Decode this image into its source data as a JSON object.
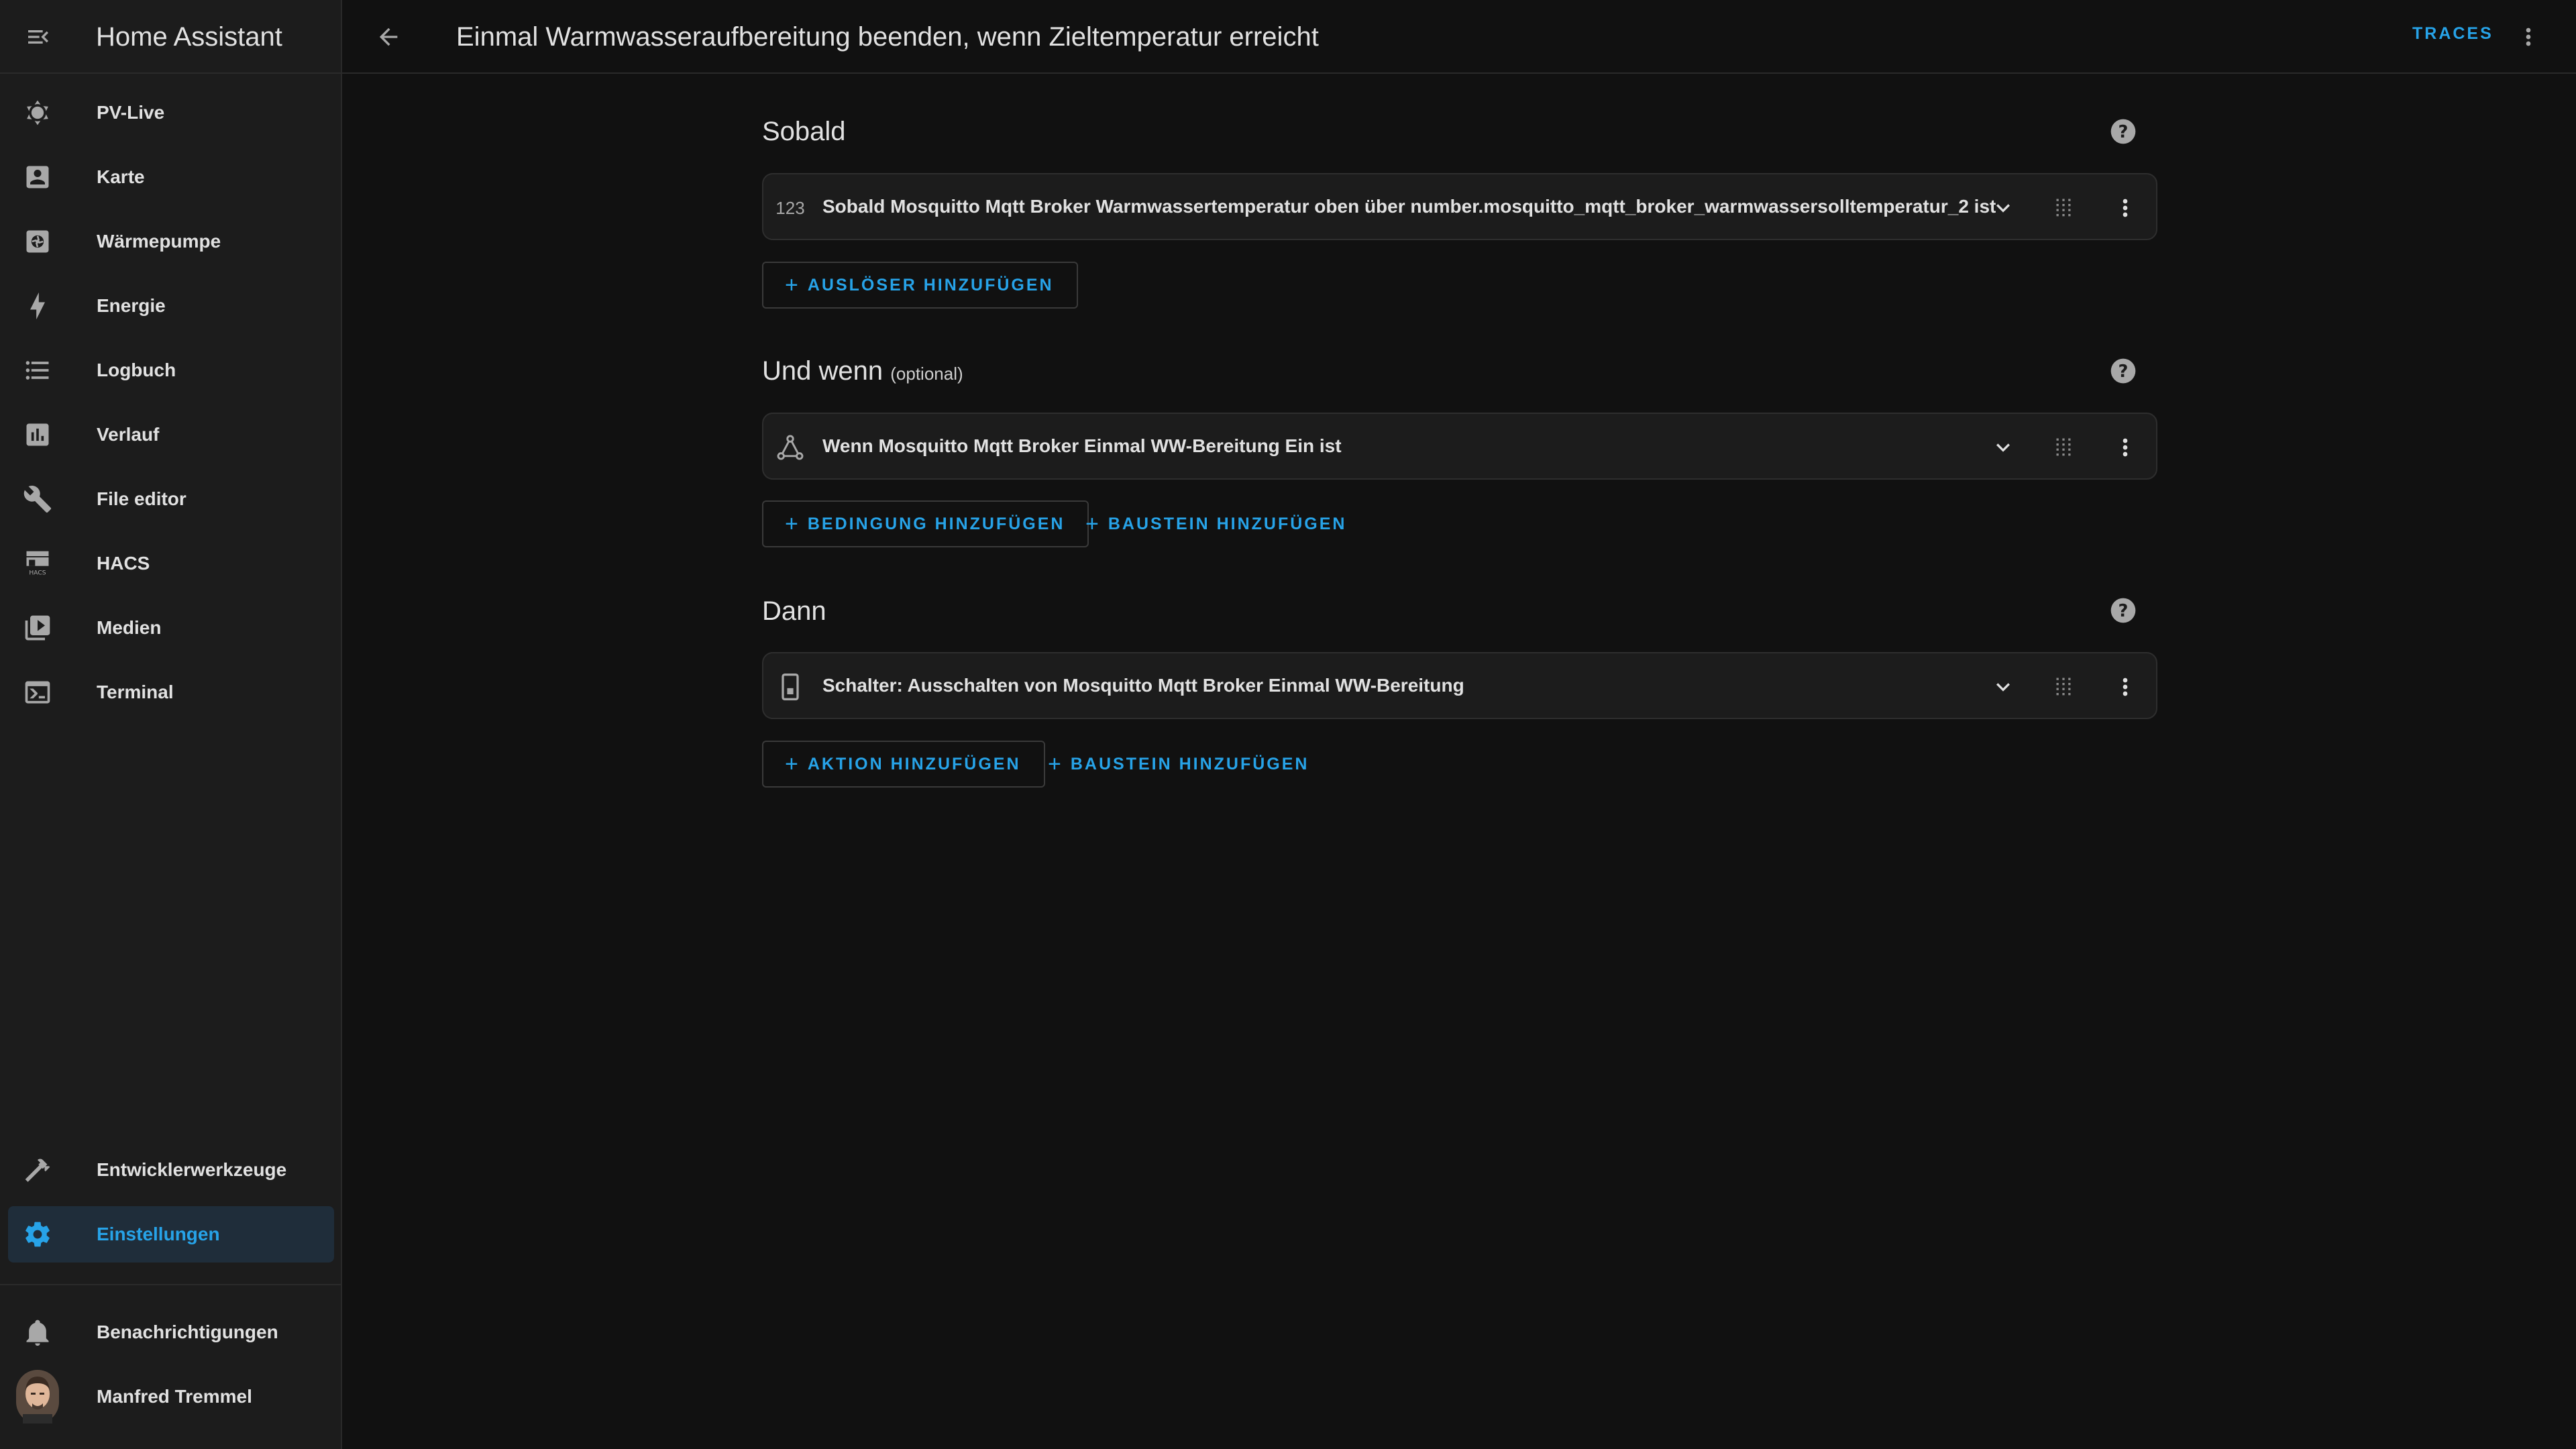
{
  "app": {
    "title": "Home Assistant",
    "accent_color": "#27a3e8",
    "menu_icon": "menu-open-icon"
  },
  "sidebar": {
    "items": [
      {
        "label": "PV-Live",
        "icon": "weather-sunny-icon"
      },
      {
        "label": "Karte",
        "icon": "account-box-icon"
      },
      {
        "label": "Wärmepumpe",
        "icon": "heat-pump-icon"
      },
      {
        "label": "Energie",
        "icon": "lightning-bolt-icon"
      },
      {
        "label": "Logbuch",
        "icon": "format-list-bulleted-icon"
      },
      {
        "label": "Verlauf",
        "icon": "chart-box-icon"
      },
      {
        "label": "File editor",
        "icon": "wrench-icon"
      },
      {
        "label": "HACS",
        "icon": "hacs-icon"
      },
      {
        "label": "Medien",
        "icon": "play-box-multiple-icon"
      },
      {
        "label": "Terminal",
        "icon": "console-icon"
      }
    ],
    "bottom_items": [
      {
        "label": "Entwicklerwerkzeuge",
        "icon": "hammer-icon"
      },
      {
        "label": "Einstellungen",
        "icon": "cog-icon",
        "active": true
      }
    ],
    "notifications": {
      "label": "Benachrichtigungen",
      "icon": "bell-icon"
    },
    "user": {
      "name": "Manfred Tremmel"
    }
  },
  "header": {
    "title": "Einmal Warmwasseraufbereitung beenden, wenn Zieltemperatur erreicht",
    "traces_label": "TRACES"
  },
  "sections": {
    "triggers": {
      "title": "Sobald",
      "card_icon_text": "123",
      "card_text": "Sobald Mosquitto Mqtt Broker Warmwassertemperatur oben über number.mosquitto_mqtt_broker_warmwassersolltemperatur_2 ist",
      "add_label": "AUSLÖSER HINZUFÜGEN"
    },
    "conditions": {
      "title": "Und wenn",
      "subtitle": "(optional)",
      "card_text": "Wenn Mosquitto Mqtt Broker Einmal WW-Bereitung Ein ist",
      "add_label": "BEDINGUNG HINZUFÜGEN",
      "add_block_label": "BAUSTEIN HINZUFÜGEN"
    },
    "actions": {
      "title": "Dann",
      "card_text": "Schalter: Ausschalten von Mosquitto Mqtt Broker Einmal WW-Bereitung",
      "add_label": "AKTION HINZUFÜGEN",
      "add_block_label": "BAUSTEIN HINZUFÜGEN"
    }
  }
}
